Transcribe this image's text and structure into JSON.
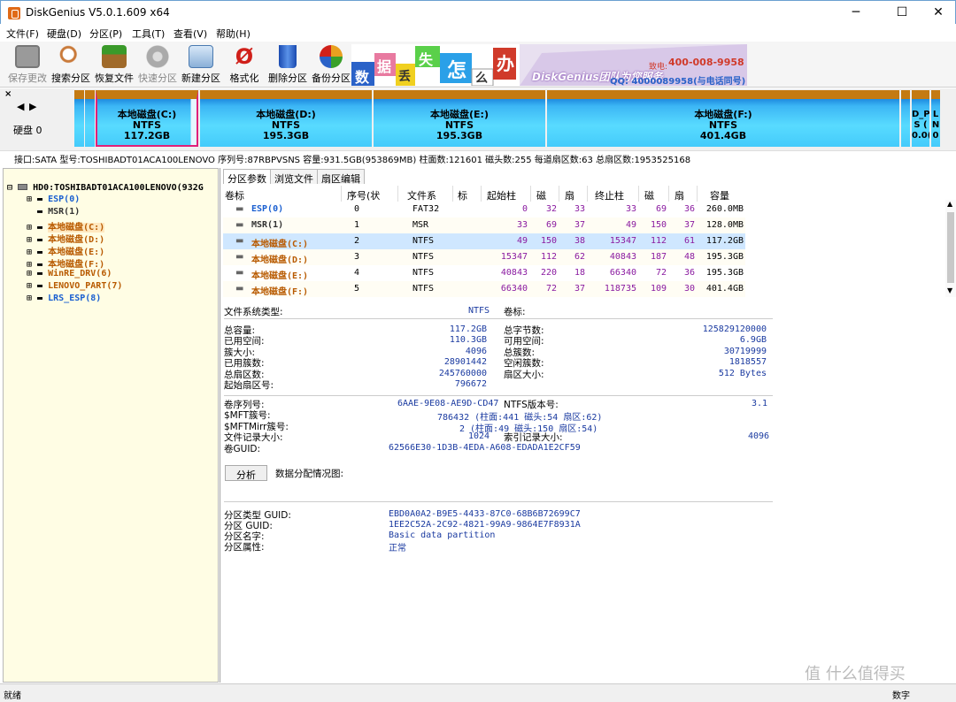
{
  "window": {
    "title": "DiskGenius V5.0.1.609 x64",
    "min": "─",
    "max": "☐",
    "close": "✕"
  },
  "menu": [
    "文件(F)",
    "硬盘(D)",
    "分区(P)",
    "工具(T)",
    "查看(V)",
    "帮助(H)"
  ],
  "toolbar": [
    {
      "label": "保存更改",
      "icon": "save-icon",
      "color": "#8a8a8a",
      "disabled": true
    },
    {
      "label": "搜索分区",
      "icon": "magnifier-icon",
      "color": "#c97a3a",
      "disabled": false
    },
    {
      "label": "恢复文件",
      "icon": "box-restore-icon",
      "color": "#b0732a",
      "disabled": false
    },
    {
      "label": "快速分区",
      "icon": "disk-quick-icon",
      "color": "#9a9a9a",
      "disabled": true
    },
    {
      "label": "新建分区",
      "icon": "new-partition-icon",
      "color": "#4a8ad0",
      "disabled": false
    },
    {
      "label": "格式化",
      "icon": "format-icon",
      "color": "#d0201a",
      "disabled": false
    },
    {
      "label": "删除分区",
      "icon": "trash-icon",
      "color": "#2a62c8",
      "disabled": false
    },
    {
      "label": "备份分区",
      "icon": "backup-icon",
      "color": "#e8a020",
      "disabled": false
    }
  ],
  "ad": {
    "chars": [
      "数",
      "据",
      "丢",
      "失",
      "怎",
      "么",
      "办"
    ],
    "brand": "DiskGenius团队为您服务",
    "phone_label": "致电:",
    "phone": "400-008-9958",
    "qq": "QQ: 4000089958(与电话同号)"
  },
  "diskmap": {
    "nav_left": "◀",
    "nav_right": "▶",
    "disk_label": "硬盘 0",
    "partitions": [
      {
        "name": "本地磁盘(C:)",
        "fs": "NTFS",
        "size": "117.2GB"
      },
      {
        "name": "本地磁盘(D:)",
        "fs": "NTFS",
        "size": "195.3GB"
      },
      {
        "name": "本地磁盘(E:)",
        "fs": "NTFS",
        "size": "195.3GB"
      },
      {
        "name": "本地磁盘(F:)",
        "fs": "NTFS",
        "size": "401.4GB"
      },
      {
        "name": "D_P",
        "fs": "S (",
        "size": "0.0("
      },
      {
        "name": "L",
        "fs": "N",
        "size": "0"
      }
    ]
  },
  "diskinfo": "接口:SATA  型号:TOSHIBADT01ACA100LENOVO  序列号:87RBPVSNS  容量:931.5GB(953869MB)  柱面数:121601  磁头数:255  每道扇区数:63  总扇区数:1953525168",
  "tree": {
    "root": "HD0:TOSHIBADT01ACA100LENOVO(932G",
    "items": [
      {
        "label": "ESP(0)",
        "color": "#1a5fd0"
      },
      {
        "label": "MSR(1)",
        "color": "#333333"
      },
      {
        "label": "本地磁盘(C:)",
        "color": "#b85a00"
      },
      {
        "label": "本地磁盘(D:)",
        "color": "#b85a00"
      },
      {
        "label": "本地磁盘(E:)",
        "color": "#b85a00"
      },
      {
        "label": "本地磁盘(F:)",
        "color": "#b85a00"
      },
      {
        "label": "WinRE_DRV(6)",
        "color": "#b85a00"
      },
      {
        "label": "LENOVO_PART(7)",
        "color": "#b85a00"
      },
      {
        "label": "LRS_ESP(8)",
        "color": "#1a5fd0"
      }
    ]
  },
  "tabs": [
    "分区参数",
    "浏览文件",
    "扇区编辑"
  ],
  "table": {
    "headers": [
      "卷标",
      "序号(状态)",
      "文件系统",
      "标识",
      "起始柱面",
      "磁头",
      "扇区",
      "终止柱面",
      "磁头",
      "扇区",
      "容量"
    ],
    "rows": [
      {
        "name": "ESP(0)",
        "color": "#1a5fd0",
        "idx": "0",
        "fs": "FAT32",
        "flag": "",
        "sc": "0",
        "sh": "32",
        "ss": "33",
        "ec": "33",
        "eh": "69",
        "es": "36",
        "cap": "260.0MB"
      },
      {
        "name": "MSR(1)",
        "color": "#333333",
        "idx": "1",
        "fs": "MSR",
        "flag": "",
        "sc": "33",
        "sh": "69",
        "ss": "37",
        "ec": "49",
        "eh": "150",
        "es": "37",
        "cap": "128.0MB"
      },
      {
        "name": "本地磁盘(C:)",
        "color": "#b85a00",
        "idx": "2",
        "fs": "NTFS",
        "flag": "",
        "sc": "49",
        "sh": "150",
        "ss": "38",
        "ec": "15347",
        "eh": "112",
        "es": "61",
        "cap": "117.2GB"
      },
      {
        "name": "本地磁盘(D:)",
        "color": "#b85a00",
        "idx": "3",
        "fs": "NTFS",
        "flag": "",
        "sc": "15347",
        "sh": "112",
        "ss": "62",
        "ec": "40843",
        "eh": "187",
        "es": "48",
        "cap": "195.3GB"
      },
      {
        "name": "本地磁盘(E:)",
        "color": "#b85a00",
        "idx": "4",
        "fs": "NTFS",
        "flag": "",
        "sc": "40843",
        "sh": "220",
        "ss": "18",
        "ec": "66340",
        "eh": "72",
        "es": "36",
        "cap": "195.3GB"
      },
      {
        "name": "本地磁盘(F:)",
        "color": "#b85a00",
        "idx": "5",
        "fs": "NTFS",
        "flag": "",
        "sc": "66340",
        "sh": "72",
        "ss": "37",
        "ec": "118735",
        "eh": "109",
        "es": "30",
        "cap": "401.4GB"
      }
    ]
  },
  "details": {
    "fs_type_label": "文件系统类型:",
    "fs_type": "NTFS",
    "vol_label_label": "卷标:",
    "left": [
      [
        "总容量:",
        "117.2GB"
      ],
      [
        "已用空间:",
        "110.3GB"
      ],
      [
        "簇大小:",
        "4096"
      ],
      [
        "已用簇数:",
        "28901442"
      ],
      [
        "总扇区数:",
        "245760000"
      ],
      [
        "起始扇区号:",
        "796672"
      ]
    ],
    "right": [
      [
        "总字节数:",
        "125829120000"
      ],
      [
        "可用空间:",
        "6.9GB"
      ],
      [
        "总簇数:",
        "30719999"
      ],
      [
        "空闲簇数:",
        "1818557"
      ],
      [
        "扇区大小:",
        "512 Bytes"
      ]
    ],
    "serial_label": "卷序列号:",
    "serial": "6AAE-9E08-AE9D-CD47",
    "ntfs_ver_label": "NTFS版本号:",
    "ntfs_ver": "3.1",
    "mft_label": "$MFT簇号:",
    "mft": "786432 (柱面:441 磁头:54 扇区:62)",
    "mftmirr_label": "$MFTMirr簇号:",
    "mftmirr": "2 (柱面:49 磁头:150 扇区:54)",
    "rec_size_label": "文件记录大小:",
    "rec_size": "1024",
    "idx_size_label": "索引记录大小:",
    "idx_size": "4096",
    "guid_label": "卷GUID:",
    "guid": "62566E30-1D3B-4EDA-A608-EDADA1E2CF59",
    "analyze_button": "分析",
    "analyze_label": "数据分配情况图:",
    "ptype_label": "分区类型 GUID:",
    "ptype": "EBD0A0A2-B9E5-4433-87C0-68B6B72699C7",
    "pguid_label": "分区 GUID:",
    "pguid": "1EE2C52A-2C92-4821-99A9-9864E7F8931A",
    "pname_label": "分区名字:",
    "pname": "Basic data partition",
    "pattr_label": "分区属性:",
    "pattr": "正常"
  },
  "status": {
    "left": "就绪",
    "right": "数字"
  },
  "watermark": "值 什么值得买"
}
